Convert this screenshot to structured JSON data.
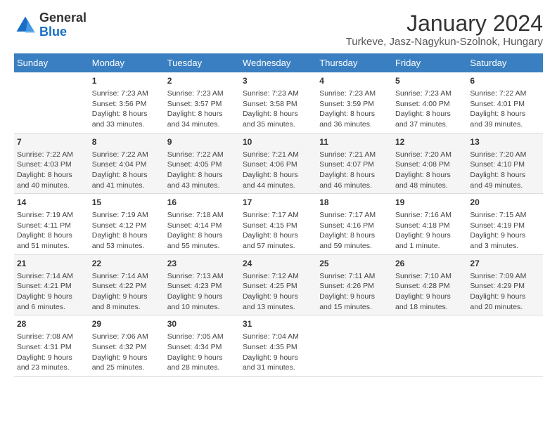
{
  "header": {
    "logo_line1": "General",
    "logo_line2": "Blue",
    "title": "January 2024",
    "subtitle": "Turkeve, Jasz-Nagykun-Szolnok, Hungary"
  },
  "days_of_week": [
    "Sunday",
    "Monday",
    "Tuesday",
    "Wednesday",
    "Thursday",
    "Friday",
    "Saturday"
  ],
  "weeks": [
    [
      {
        "day": "",
        "content": ""
      },
      {
        "day": "1",
        "content": "Sunrise: 7:23 AM\nSunset: 3:56 PM\nDaylight: 8 hours\nand 33 minutes."
      },
      {
        "day": "2",
        "content": "Sunrise: 7:23 AM\nSunset: 3:57 PM\nDaylight: 8 hours\nand 34 minutes."
      },
      {
        "day": "3",
        "content": "Sunrise: 7:23 AM\nSunset: 3:58 PM\nDaylight: 8 hours\nand 35 minutes."
      },
      {
        "day": "4",
        "content": "Sunrise: 7:23 AM\nSunset: 3:59 PM\nDaylight: 8 hours\nand 36 minutes."
      },
      {
        "day": "5",
        "content": "Sunrise: 7:23 AM\nSunset: 4:00 PM\nDaylight: 8 hours\nand 37 minutes."
      },
      {
        "day": "6",
        "content": "Sunrise: 7:22 AM\nSunset: 4:01 PM\nDaylight: 8 hours\nand 39 minutes."
      }
    ],
    [
      {
        "day": "7",
        "content": "Sunrise: 7:22 AM\nSunset: 4:03 PM\nDaylight: 8 hours\nand 40 minutes."
      },
      {
        "day": "8",
        "content": "Sunrise: 7:22 AM\nSunset: 4:04 PM\nDaylight: 8 hours\nand 41 minutes."
      },
      {
        "day": "9",
        "content": "Sunrise: 7:22 AM\nSunset: 4:05 PM\nDaylight: 8 hours\nand 43 minutes."
      },
      {
        "day": "10",
        "content": "Sunrise: 7:21 AM\nSunset: 4:06 PM\nDaylight: 8 hours\nand 44 minutes."
      },
      {
        "day": "11",
        "content": "Sunrise: 7:21 AM\nSunset: 4:07 PM\nDaylight: 8 hours\nand 46 minutes."
      },
      {
        "day": "12",
        "content": "Sunrise: 7:20 AM\nSunset: 4:08 PM\nDaylight: 8 hours\nand 48 minutes."
      },
      {
        "day": "13",
        "content": "Sunrise: 7:20 AM\nSunset: 4:10 PM\nDaylight: 8 hours\nand 49 minutes."
      }
    ],
    [
      {
        "day": "14",
        "content": "Sunrise: 7:19 AM\nSunset: 4:11 PM\nDaylight: 8 hours\nand 51 minutes."
      },
      {
        "day": "15",
        "content": "Sunrise: 7:19 AM\nSunset: 4:12 PM\nDaylight: 8 hours\nand 53 minutes."
      },
      {
        "day": "16",
        "content": "Sunrise: 7:18 AM\nSunset: 4:14 PM\nDaylight: 8 hours\nand 55 minutes."
      },
      {
        "day": "17",
        "content": "Sunrise: 7:17 AM\nSunset: 4:15 PM\nDaylight: 8 hours\nand 57 minutes."
      },
      {
        "day": "18",
        "content": "Sunrise: 7:17 AM\nSunset: 4:16 PM\nDaylight: 8 hours\nand 59 minutes."
      },
      {
        "day": "19",
        "content": "Sunrise: 7:16 AM\nSunset: 4:18 PM\nDaylight: 9 hours\nand 1 minute."
      },
      {
        "day": "20",
        "content": "Sunrise: 7:15 AM\nSunset: 4:19 PM\nDaylight: 9 hours\nand 3 minutes."
      }
    ],
    [
      {
        "day": "21",
        "content": "Sunrise: 7:14 AM\nSunset: 4:21 PM\nDaylight: 9 hours\nand 6 minutes."
      },
      {
        "day": "22",
        "content": "Sunrise: 7:14 AM\nSunset: 4:22 PM\nDaylight: 9 hours\nand 8 minutes."
      },
      {
        "day": "23",
        "content": "Sunrise: 7:13 AM\nSunset: 4:23 PM\nDaylight: 9 hours\nand 10 minutes."
      },
      {
        "day": "24",
        "content": "Sunrise: 7:12 AM\nSunset: 4:25 PM\nDaylight: 9 hours\nand 13 minutes."
      },
      {
        "day": "25",
        "content": "Sunrise: 7:11 AM\nSunset: 4:26 PM\nDaylight: 9 hours\nand 15 minutes."
      },
      {
        "day": "26",
        "content": "Sunrise: 7:10 AM\nSunset: 4:28 PM\nDaylight: 9 hours\nand 18 minutes."
      },
      {
        "day": "27",
        "content": "Sunrise: 7:09 AM\nSunset: 4:29 PM\nDaylight: 9 hours\nand 20 minutes."
      }
    ],
    [
      {
        "day": "28",
        "content": "Sunrise: 7:08 AM\nSunset: 4:31 PM\nDaylight: 9 hours\nand 23 minutes."
      },
      {
        "day": "29",
        "content": "Sunrise: 7:06 AM\nSunset: 4:32 PM\nDaylight: 9 hours\nand 25 minutes."
      },
      {
        "day": "30",
        "content": "Sunrise: 7:05 AM\nSunset: 4:34 PM\nDaylight: 9 hours\nand 28 minutes."
      },
      {
        "day": "31",
        "content": "Sunrise: 7:04 AM\nSunset: 4:35 PM\nDaylight: 9 hours\nand 31 minutes."
      },
      {
        "day": "",
        "content": ""
      },
      {
        "day": "",
        "content": ""
      },
      {
        "day": "",
        "content": ""
      }
    ]
  ]
}
